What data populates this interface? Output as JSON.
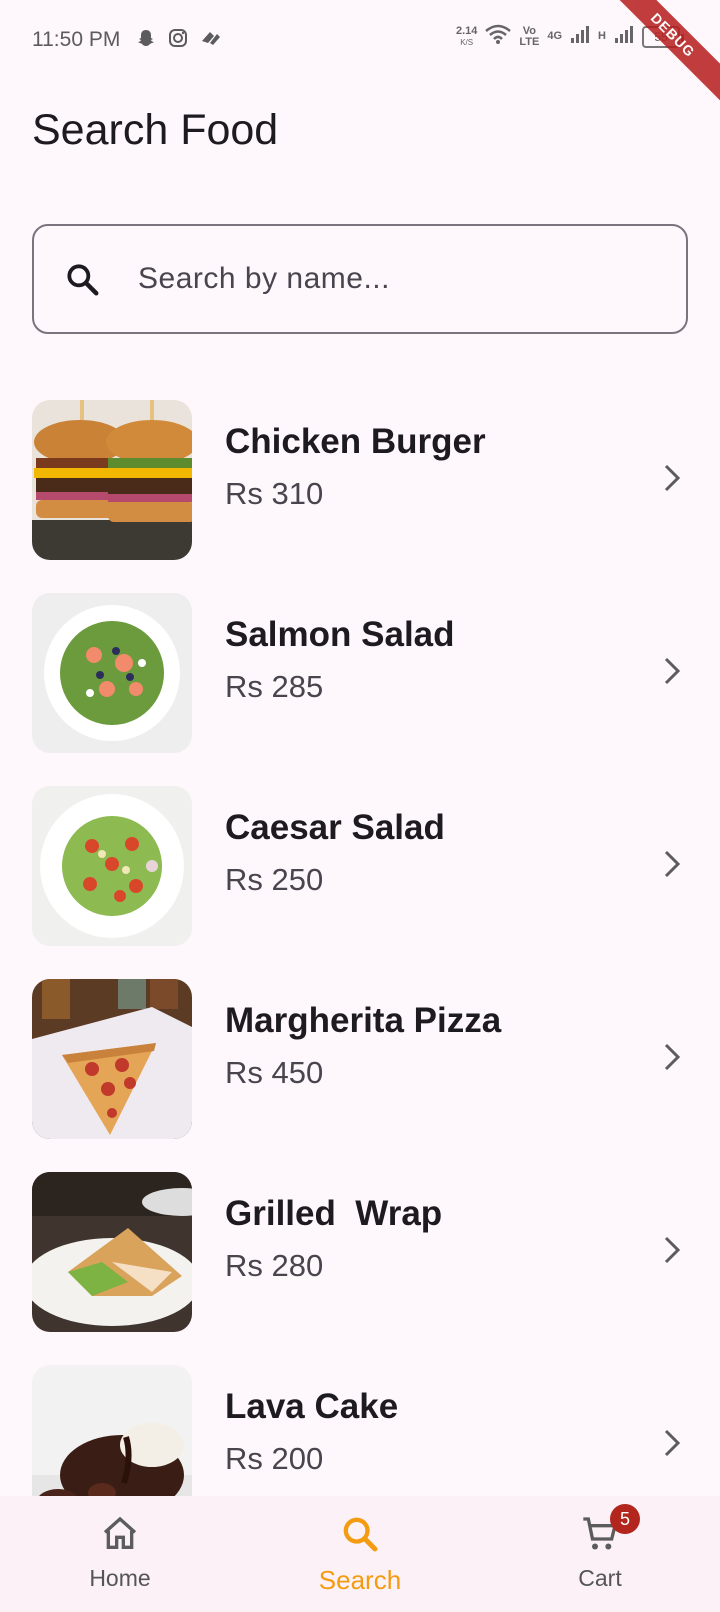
{
  "status_bar": {
    "time": "11:50 PM",
    "speed_value": "2.14",
    "speed_unit": "K/S",
    "net_label_top": "Vo",
    "net_label_bottom": "LTE",
    "net_4g": "4G",
    "net_h": "H",
    "battery": "55",
    "debug_label": "DEBUG"
  },
  "header": {
    "title": "Search Food"
  },
  "search": {
    "placeholder": "Search by name..."
  },
  "foods": [
    {
      "name": "Chicken Burger",
      "price": "Rs 310",
      "image": "burger"
    },
    {
      "name": "Salmon Salad",
      "price": "Rs 285",
      "image": "salmon-salad"
    },
    {
      "name": "Caesar Salad",
      "price": "Rs 250",
      "image": "caesar-salad"
    },
    {
      "name": "Margherita Pizza",
      "price": "Rs 450",
      "image": "pizza"
    },
    {
      "name": "Grilled  Wrap",
      "price": "Rs 280",
      "image": "wrap"
    },
    {
      "name": "Lava Cake",
      "price": "Rs 200",
      "image": "lava-cake"
    }
  ],
  "nav": {
    "home": "Home",
    "search": "Search",
    "cart": "Cart",
    "cart_badge": "5",
    "active": "search"
  },
  "colors": {
    "accent": "#f39c12",
    "badge": "#b3261e",
    "background": "#fef7fb"
  }
}
